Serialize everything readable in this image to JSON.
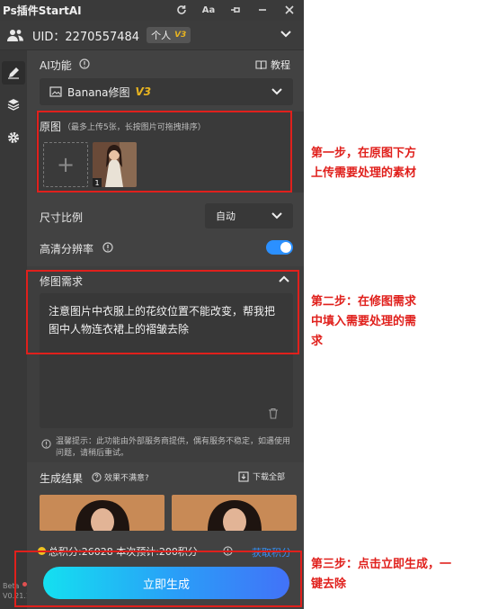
{
  "app": {
    "title": "Ps插件StartAI"
  },
  "titlebar": {
    "font_label": "Aa"
  },
  "user": {
    "uid": "UID：2270557484",
    "tier": "个人",
    "tier_badge": "V3"
  },
  "ai": {
    "label": "AI功能",
    "tutorial": "教程",
    "function_name": "Banana修图",
    "function_badge": "V3"
  },
  "source": {
    "label": "原图",
    "hint": "（最多上传5张，长按图片可拖拽排序）",
    "add": "+",
    "thumb_index": "1"
  },
  "size": {
    "label": "尺寸比例",
    "value": "自动"
  },
  "hd": {
    "label": "高清分辨率",
    "enabled": true
  },
  "request": {
    "label": "修图需求",
    "text": "注意图片中衣服上的花纹位置不能改变，帮我把图中人物连衣裙上的褶皱去除",
    "notice": "温馨提示：此功能由外部服务商提供，偶有服务不稳定，如遇使用问题，请稍后重试。"
  },
  "result": {
    "label": "生成结果",
    "feedback": "效果不满意?",
    "download_all": "下载全部"
  },
  "points": {
    "summary": "总积分:26028 本次预计:200积分",
    "get_points": "获取积分"
  },
  "generate_button": "立即生成",
  "version": {
    "beta": "Beta",
    "number": "V0.21.1"
  },
  "annotations": {
    "step1_line1": "第一步，在原图下方",
    "step1_line2": "上传需要处理的素材",
    "step2_line1": "第二步：在修图需求",
    "step2_line2": "中填入需要处理的需",
    "step2_line3": "求",
    "step3_line1": "第三步：点击立即生成，一",
    "step3_line2": "键去除"
  },
  "colors": {
    "annotation_red": "#e0201c",
    "accent_blue": "#2b90ff",
    "badge_gold": "#e8b420",
    "link_blue": "#3a8ef5"
  }
}
